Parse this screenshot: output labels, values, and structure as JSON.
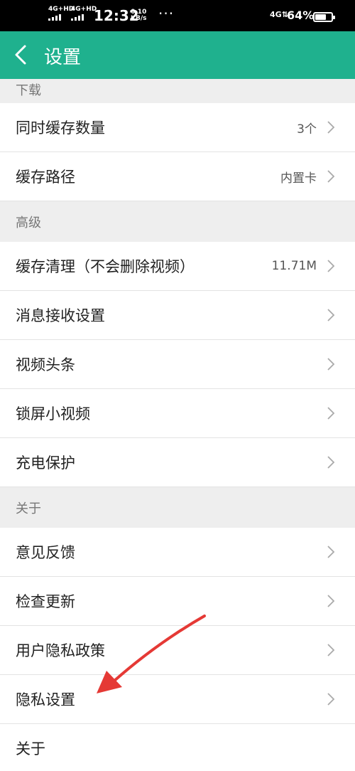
{
  "status_bar": {
    "net1": "4G+HD",
    "net2": "4G+HD",
    "time": "12:32",
    "speed_value": "0.10",
    "speed_unit": "KB/s",
    "dots": "···",
    "net_right": "4G⇅",
    "battery": "64%"
  },
  "header": {
    "title": "设置"
  },
  "sections": {
    "download": {
      "title": "下载",
      "items": [
        {
          "label": "同时缓存数量",
          "value": "3个"
        },
        {
          "label": "缓存路径",
          "value": "内置卡"
        }
      ]
    },
    "advanced": {
      "title": "高级",
      "items": [
        {
          "label": "缓存清理（不会删除视频）",
          "value": "11.71M"
        },
        {
          "label": "消息接收设置"
        },
        {
          "label": "视频头条"
        },
        {
          "label": "锁屏小视频"
        },
        {
          "label": "充电保护"
        }
      ]
    },
    "about": {
      "title": "关于",
      "items": [
        {
          "label": "意见反馈"
        },
        {
          "label": "检查更新"
        },
        {
          "label": "用户隐私政策"
        },
        {
          "label": "隐私设置"
        },
        {
          "label": "关于"
        }
      ]
    }
  },
  "colors": {
    "accent": "#1fb18e",
    "annotation": "#e53935"
  }
}
